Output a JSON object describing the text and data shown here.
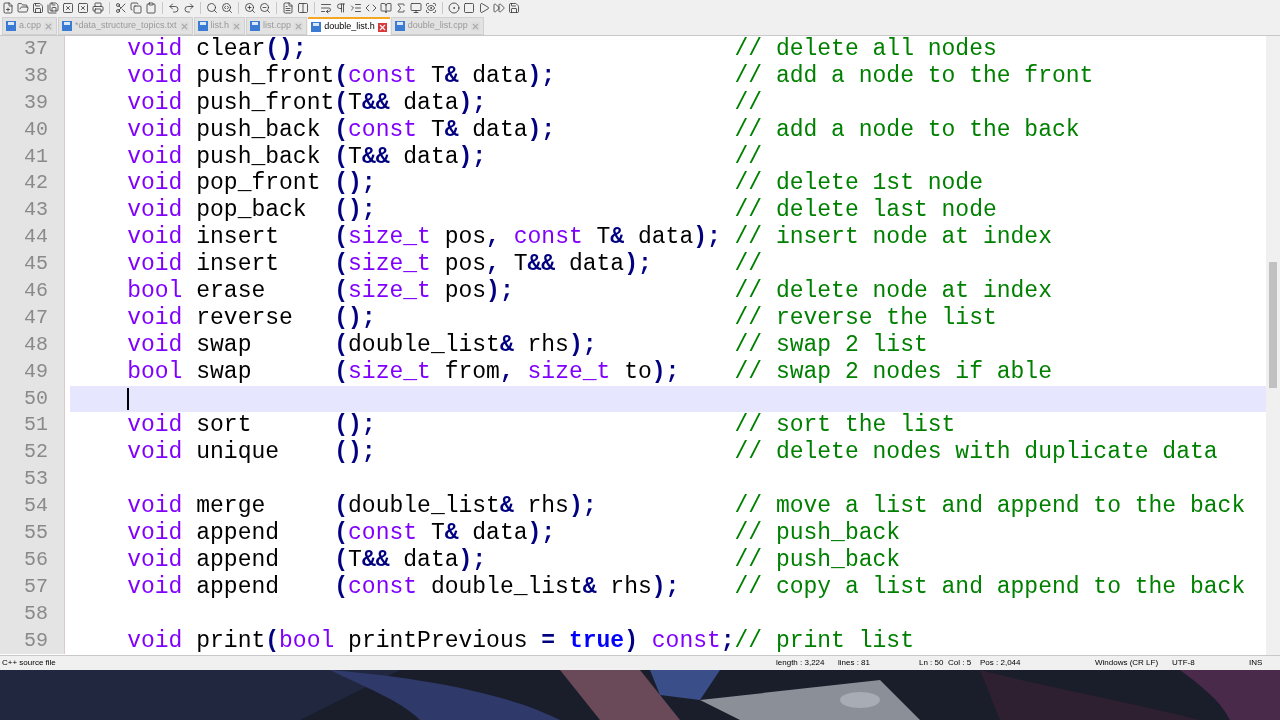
{
  "tabs": [
    {
      "label": "a.cpp",
      "selected": false
    },
    {
      "label": "*data_structure_topics.txt",
      "selected": false
    },
    {
      "label": "list.h",
      "selected": false
    },
    {
      "label": "list.cpp",
      "selected": false
    },
    {
      "label": "double_list.h",
      "selected": true
    },
    {
      "label": "double_list.cpp",
      "selected": false
    }
  ],
  "lines": [
    {
      "number": "37",
      "current": false,
      "code": [
        {
          "kind": "keyword",
          "text": "void"
        },
        {
          "kind": "plain",
          "text": " clear"
        },
        {
          "kind": "operator",
          "text": "();"
        }
      ],
      "comment": "// delete all nodes"
    },
    {
      "number": "38",
      "current": false,
      "code": [
        {
          "kind": "keyword",
          "text": "void"
        },
        {
          "kind": "plain",
          "text": " push_front"
        },
        {
          "kind": "operator",
          "text": "("
        },
        {
          "kind": "keyword",
          "text": "const"
        },
        {
          "kind": "plain",
          "text": " T"
        },
        {
          "kind": "operator",
          "text": "&"
        },
        {
          "kind": "plain",
          "text": " data"
        },
        {
          "kind": "operator",
          "text": ");"
        }
      ],
      "comment": "// add a node to the front"
    },
    {
      "number": "39",
      "current": false,
      "code": [
        {
          "kind": "keyword",
          "text": "void"
        },
        {
          "kind": "plain",
          "text": " push_front"
        },
        {
          "kind": "operator",
          "text": "("
        },
        {
          "kind": "plain",
          "text": "T"
        },
        {
          "kind": "operator",
          "text": "&&"
        },
        {
          "kind": "plain",
          "text": " data"
        },
        {
          "kind": "operator",
          "text": ");"
        }
      ],
      "comment": "//"
    },
    {
      "number": "40",
      "current": false,
      "code": [
        {
          "kind": "keyword",
          "text": "void"
        },
        {
          "kind": "plain",
          "text": " push_back "
        },
        {
          "kind": "operator",
          "text": "("
        },
        {
          "kind": "keyword",
          "text": "const"
        },
        {
          "kind": "plain",
          "text": " T"
        },
        {
          "kind": "operator",
          "text": "&"
        },
        {
          "kind": "plain",
          "text": " data"
        },
        {
          "kind": "operator",
          "text": ");"
        }
      ],
      "comment": "// add a node to the back"
    },
    {
      "number": "41",
      "current": false,
      "code": [
        {
          "kind": "keyword",
          "text": "void"
        },
        {
          "kind": "plain",
          "text": " push_back "
        },
        {
          "kind": "operator",
          "text": "("
        },
        {
          "kind": "plain",
          "text": "T"
        },
        {
          "kind": "operator",
          "text": "&&"
        },
        {
          "kind": "plain",
          "text": " data"
        },
        {
          "kind": "operator",
          "text": ");"
        }
      ],
      "comment": "//"
    },
    {
      "number": "42",
      "current": false,
      "code": [
        {
          "kind": "keyword",
          "text": "void"
        },
        {
          "kind": "plain",
          "text": " pop_front "
        },
        {
          "kind": "operator",
          "text": "();"
        }
      ],
      "comment": "// delete 1st node"
    },
    {
      "number": "43",
      "current": false,
      "code": [
        {
          "kind": "keyword",
          "text": "void"
        },
        {
          "kind": "plain",
          "text": " pop_back  "
        },
        {
          "kind": "operator",
          "text": "();"
        }
      ],
      "comment": "// delete last node"
    },
    {
      "number": "44",
      "current": false,
      "code": [
        {
          "kind": "keyword",
          "text": "void"
        },
        {
          "kind": "plain",
          "text": " insert    "
        },
        {
          "kind": "operator",
          "text": "("
        },
        {
          "kind": "keyword",
          "text": "size_t"
        },
        {
          "kind": "plain",
          "text": " pos"
        },
        {
          "kind": "operator",
          "text": ","
        },
        {
          "kind": "keyword",
          "text": " const"
        },
        {
          "kind": "plain",
          "text": " T"
        },
        {
          "kind": "operator",
          "text": "&"
        },
        {
          "kind": "plain",
          "text": " data"
        },
        {
          "kind": "operator",
          "text": ");"
        }
      ],
      "comment": "// insert node at index"
    },
    {
      "number": "45",
      "current": false,
      "code": [
        {
          "kind": "keyword",
          "text": "void"
        },
        {
          "kind": "plain",
          "text": " insert    "
        },
        {
          "kind": "operator",
          "text": "("
        },
        {
          "kind": "keyword",
          "text": "size_t"
        },
        {
          "kind": "plain",
          "text": " pos"
        },
        {
          "kind": "operator",
          "text": ","
        },
        {
          "kind": "plain",
          "text": " T"
        },
        {
          "kind": "operator",
          "text": "&&"
        },
        {
          "kind": "plain",
          "text": " data"
        },
        {
          "kind": "operator",
          "text": ");"
        }
      ],
      "comment": "//"
    },
    {
      "number": "46",
      "current": false,
      "code": [
        {
          "kind": "keyword",
          "text": "bool"
        },
        {
          "kind": "plain",
          "text": " erase     "
        },
        {
          "kind": "operator",
          "text": "("
        },
        {
          "kind": "keyword",
          "text": "size_t"
        },
        {
          "kind": "plain",
          "text": " pos"
        },
        {
          "kind": "operator",
          "text": ");"
        }
      ],
      "comment": "// delete node at index"
    },
    {
      "number": "47",
      "current": false,
      "code": [
        {
          "kind": "keyword",
          "text": "void"
        },
        {
          "kind": "plain",
          "text": " reverse   "
        },
        {
          "kind": "operator",
          "text": "();"
        }
      ],
      "comment": "// reverse the list"
    },
    {
      "number": "48",
      "current": false,
      "code": [
        {
          "kind": "keyword",
          "text": "void"
        },
        {
          "kind": "plain",
          "text": " swap      "
        },
        {
          "kind": "operator",
          "text": "("
        },
        {
          "kind": "plain",
          "text": "double_list"
        },
        {
          "kind": "operator",
          "text": "&"
        },
        {
          "kind": "plain",
          "text": " rhs"
        },
        {
          "kind": "operator",
          "text": ");"
        }
      ],
      "comment": "// swap 2 list"
    },
    {
      "number": "49",
      "current": false,
      "code": [
        {
          "kind": "keyword",
          "text": "bool"
        },
        {
          "kind": "plain",
          "text": " swap      "
        },
        {
          "kind": "operator",
          "text": "("
        },
        {
          "kind": "keyword",
          "text": "size_t"
        },
        {
          "kind": "plain",
          "text": " from"
        },
        {
          "kind": "operator",
          "text": ","
        },
        {
          "kind": "keyword",
          "text": " size_t"
        },
        {
          "kind": "plain",
          "text": " to"
        },
        {
          "kind": "operator",
          "text": ");"
        }
      ],
      "comment": "// swap 2 nodes if able"
    },
    {
      "number": "50",
      "current": true
    },
    {
      "number": "51",
      "current": false,
      "code": [
        {
          "kind": "keyword",
          "text": "void"
        },
        {
          "kind": "plain",
          "text": " sort      "
        },
        {
          "kind": "operator",
          "text": "();"
        }
      ],
      "comment": "// sort the list"
    },
    {
      "number": "52",
      "current": false,
      "code": [
        {
          "kind": "keyword",
          "text": "void"
        },
        {
          "kind": "plain",
          "text": " unique    "
        },
        {
          "kind": "operator",
          "text": "();"
        }
      ],
      "comment": "// delete nodes with duplicate data"
    },
    {
      "number": "53",
      "current": false
    },
    {
      "number": "54",
      "current": false,
      "code": [
        {
          "kind": "keyword",
          "text": "void"
        },
        {
          "kind": "plain",
          "text": " merge     "
        },
        {
          "kind": "operator",
          "text": "("
        },
        {
          "kind": "plain",
          "text": "double_list"
        },
        {
          "kind": "operator",
          "text": "&"
        },
        {
          "kind": "plain",
          "text": " rhs"
        },
        {
          "kind": "operator",
          "text": ");"
        }
      ],
      "comment": "// move a list and append to the back"
    },
    {
      "number": "55",
      "current": false,
      "code": [
        {
          "kind": "keyword",
          "text": "void"
        },
        {
          "kind": "plain",
          "text": " append    "
        },
        {
          "kind": "operator",
          "text": "("
        },
        {
          "kind": "keyword",
          "text": "const"
        },
        {
          "kind": "plain",
          "text": " T"
        },
        {
          "kind": "operator",
          "text": "&"
        },
        {
          "kind": "plain",
          "text": " data"
        },
        {
          "kind": "operator",
          "text": ");"
        }
      ],
      "comment": "// push_back"
    },
    {
      "number": "56",
      "current": false,
      "code": [
        {
          "kind": "keyword",
          "text": "void"
        },
        {
          "kind": "plain",
          "text": " append    "
        },
        {
          "kind": "operator",
          "text": "("
        },
        {
          "kind": "plain",
          "text": "T"
        },
        {
          "kind": "operator",
          "text": "&&"
        },
        {
          "kind": "plain",
          "text": " data"
        },
        {
          "kind": "operator",
          "text": ");"
        }
      ],
      "comment": "// push_back"
    },
    {
      "number": "57",
      "current": false,
      "code": [
        {
          "kind": "keyword",
          "text": "void"
        },
        {
          "kind": "plain",
          "text": " append    "
        },
        {
          "kind": "operator",
          "text": "("
        },
        {
          "kind": "keyword",
          "text": "const"
        },
        {
          "kind": "plain",
          "text": " double_list"
        },
        {
          "kind": "operator",
          "text": "&"
        },
        {
          "kind": "plain",
          "text": " rhs"
        },
        {
          "kind": "operator",
          "text": ");"
        }
      ],
      "comment": "// copy a list and append to the back"
    },
    {
      "number": "58",
      "current": false
    },
    {
      "number": "59",
      "current": false,
      "code": [
        {
          "kind": "keyword",
          "text": "void"
        },
        {
          "kind": "plain",
          "text": " print"
        },
        {
          "kind": "operator",
          "text": "("
        },
        {
          "kind": "keyword",
          "text": "bool"
        },
        {
          "kind": "plain",
          "text": " printPrevious "
        },
        {
          "kind": "operator",
          "text": "="
        },
        {
          "kind": "literal",
          "text": " true"
        },
        {
          "kind": "operator",
          "text": ")"
        },
        {
          "kind": "keyword",
          "text": " const"
        },
        {
          "kind": "operator",
          "text": ";"
        }
      ],
      "comment": "// print list"
    }
  ],
  "status_bar": {
    "file_type": "C++ source file",
    "length": "length : 3,224",
    "lines": "lines : 81",
    "line": "Ln : 50",
    "column": "Col : 5",
    "position": "Pos : 2,044",
    "eol": "Windows (CR LF)",
    "encoding": "UTF-8",
    "mode": "INS"
  }
}
